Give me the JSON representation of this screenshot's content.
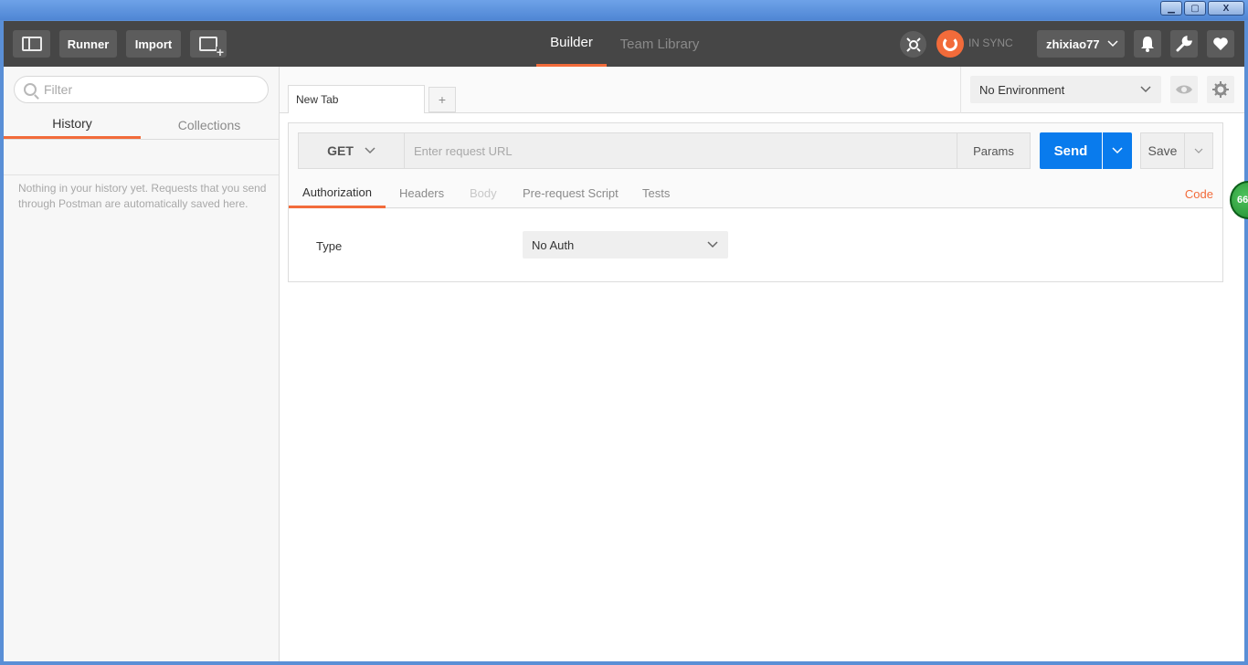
{
  "window": {
    "minimize": "▁",
    "maximize": "▢",
    "close": "X"
  },
  "header": {
    "runner_label": "Runner",
    "import_label": "Import",
    "tabs": [
      "Builder",
      "Team Library"
    ],
    "sync_status": "IN SYNC",
    "username": "zhixiao77"
  },
  "sidebar": {
    "filter_placeholder": "Filter",
    "tabs": [
      "History",
      "Collections"
    ],
    "empty_message": "Nothing in your history yet. Requests that you send through Postman are automatically saved here."
  },
  "tabs": {
    "active_tab": "New Tab",
    "add_tab": "+"
  },
  "environment": {
    "selected": "No Environment"
  },
  "request": {
    "method": "GET",
    "url_placeholder": "Enter request URL",
    "params_label": "Params",
    "send_label": "Send",
    "save_label": "Save",
    "subtabs": [
      "Authorization",
      "Headers",
      "Body",
      "Pre-request Script",
      "Tests"
    ],
    "code_label": "Code"
  },
  "authorization": {
    "type_label": "Type",
    "type_value": "No Auth"
  },
  "badge": {
    "value": "66"
  },
  "colors": {
    "accent": "#f26b3a",
    "send_blue": "#097bed",
    "header_bg": "#464646"
  }
}
